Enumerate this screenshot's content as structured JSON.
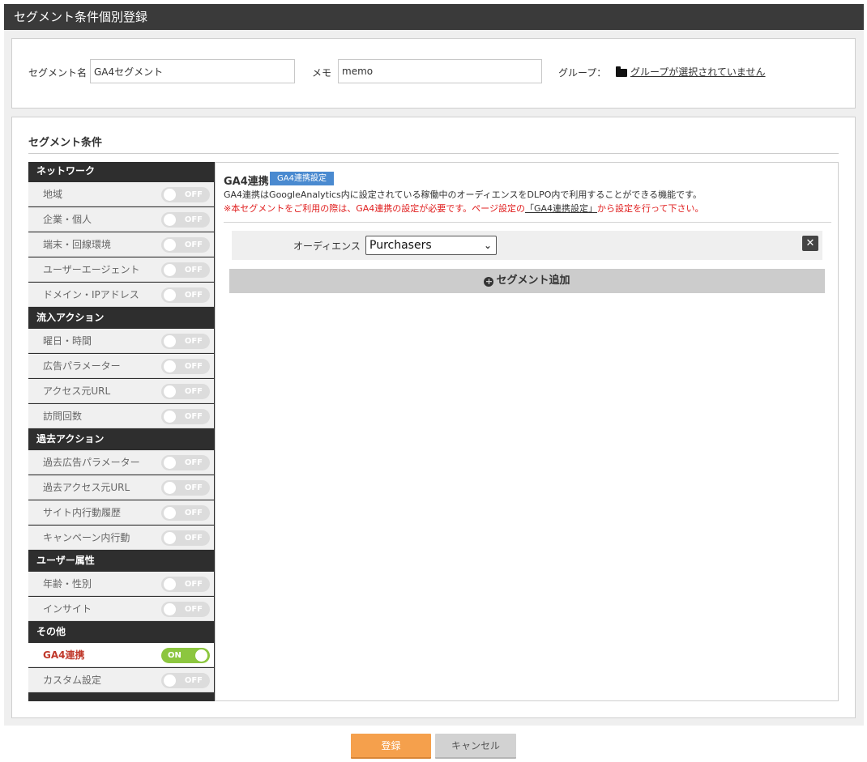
{
  "page_title": "セグメント条件個別登録",
  "form": {
    "name_label": "セグメント名",
    "name_value": "GA4セグメント",
    "memo_label": "メモ",
    "memo_value": "memo",
    "group_label": "グループ：",
    "group_link": "グループが選択されていません"
  },
  "conditions_title": "セグメント条件",
  "sidebar": {
    "categories": [
      {
        "label": "ネットワーク",
        "items": [
          {
            "label": "地域",
            "state": "OFF"
          },
          {
            "label": "企業・個人",
            "state": "OFF"
          },
          {
            "label": "端末・回線環境",
            "state": "OFF"
          },
          {
            "label": "ユーザーエージェント",
            "state": "OFF"
          },
          {
            "label": "ドメイン・IPアドレス",
            "state": "OFF"
          }
        ]
      },
      {
        "label": "流入アクション",
        "items": [
          {
            "label": "曜日・時間",
            "state": "OFF"
          },
          {
            "label": "広告パラメーター",
            "state": "OFF"
          },
          {
            "label": "アクセス元URL",
            "state": "OFF"
          },
          {
            "label": "訪問回数",
            "state": "OFF"
          }
        ]
      },
      {
        "label": "過去アクション",
        "items": [
          {
            "label": "過去広告パラメーター",
            "state": "OFF"
          },
          {
            "label": "過去アクセス元URL",
            "state": "OFF"
          },
          {
            "label": "サイト内行動履歴",
            "state": "OFF"
          },
          {
            "label": "キャンペーン内行動",
            "state": "OFF"
          }
        ]
      },
      {
        "label": "ユーザー属性",
        "items": [
          {
            "label": "年齢・性別",
            "state": "OFF"
          },
          {
            "label": "インサイト",
            "state": "OFF"
          }
        ]
      },
      {
        "label": "その他",
        "items": [
          {
            "label": "GA4連携",
            "state": "ON"
          },
          {
            "label": "カスタム設定",
            "state": "OFF"
          }
        ]
      }
    ]
  },
  "content": {
    "title": "GA4連携",
    "badge": "GA4連携設定",
    "description": "GA4連携はGoogleAnalytics内に設定されている稼働中のオーディエンスをDLPO内で利用することができる機能です。",
    "warning_prefix": "※本セグメントをご利用の際は、GA4連携の設定が必要です。ページ設定の",
    "warning_link": "「GA4連携設定」",
    "warning_suffix": "から設定を行って下さい。",
    "audience_label": "オーディエンス",
    "audience_value": "Purchasers",
    "close_symbol": "✕",
    "add_label": "セグメント追加"
  },
  "buttons": {
    "submit": "登録",
    "cancel": "キャンセル"
  },
  "colors": {
    "header_bg": "#3a3a3a",
    "toggle_on": "#8cc63f",
    "badge": "#4a8ad0",
    "warning": "#e02020",
    "submit": "#f5a04c"
  }
}
